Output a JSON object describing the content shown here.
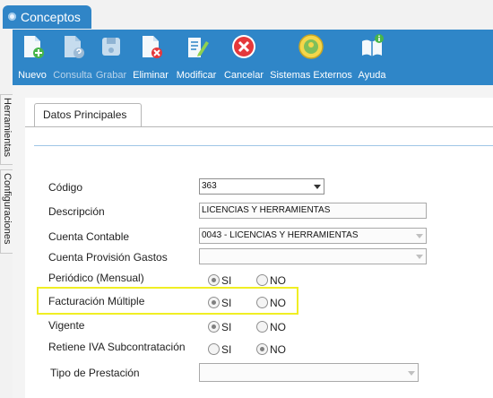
{
  "window": {
    "title": "Conceptos"
  },
  "toolbar": {
    "items": [
      {
        "label": "Nuevo",
        "icon": "new-document-icon",
        "enabled": true
      },
      {
        "label": "Consulta",
        "icon": "query-document-icon",
        "enabled": false
      },
      {
        "label": "Grabar",
        "icon": "save-icon",
        "enabled": false
      },
      {
        "label": "Eliminar",
        "icon": "delete-document-icon",
        "enabled": true
      },
      {
        "label": "Modificar",
        "icon": "edit-document-icon",
        "enabled": true
      },
      {
        "label": "Cancelar",
        "icon": "cancel-icon",
        "enabled": true
      },
      {
        "label": "Sistemas Externos",
        "icon": "external-systems-icon",
        "enabled": true
      },
      {
        "label": "Ayuda",
        "icon": "help-book-icon",
        "enabled": true
      }
    ]
  },
  "side_tabs": [
    "Herramientas",
    "Configuraciones"
  ],
  "panel_tab": "Datos Principales",
  "form": {
    "codigo": {
      "label": "Código",
      "value": "363"
    },
    "descripcion": {
      "label": "Descripción",
      "value": "LICENCIAS Y HERRAMIENTAS"
    },
    "cuenta_contable": {
      "label": "Cuenta Contable",
      "value": "0043 - LICENCIAS Y HERRAMIENTAS"
    },
    "cuenta_provision": {
      "label": "Cuenta Provisión Gastos",
      "value": ""
    },
    "periodico": {
      "label": "Periódico (Mensual)",
      "si": "SI",
      "no": "NO",
      "selected": "SI"
    },
    "facturacion": {
      "label": "Facturación Múltiple",
      "si": "SI",
      "no": "NO",
      "selected": "SI"
    },
    "vigente": {
      "label": "Vigente",
      "si": "SI",
      "no": "NO",
      "selected": "SI"
    },
    "retiene_iva": {
      "label": "Retiene IVA Subcontratación",
      "si": "SI",
      "no": "NO",
      "selected": "NO"
    },
    "tipo_prestacion": {
      "label": "Tipo de Prestación",
      "value": ""
    }
  },
  "colors": {
    "toolbar": "#2f86c8",
    "highlight": "#f0ee23"
  }
}
